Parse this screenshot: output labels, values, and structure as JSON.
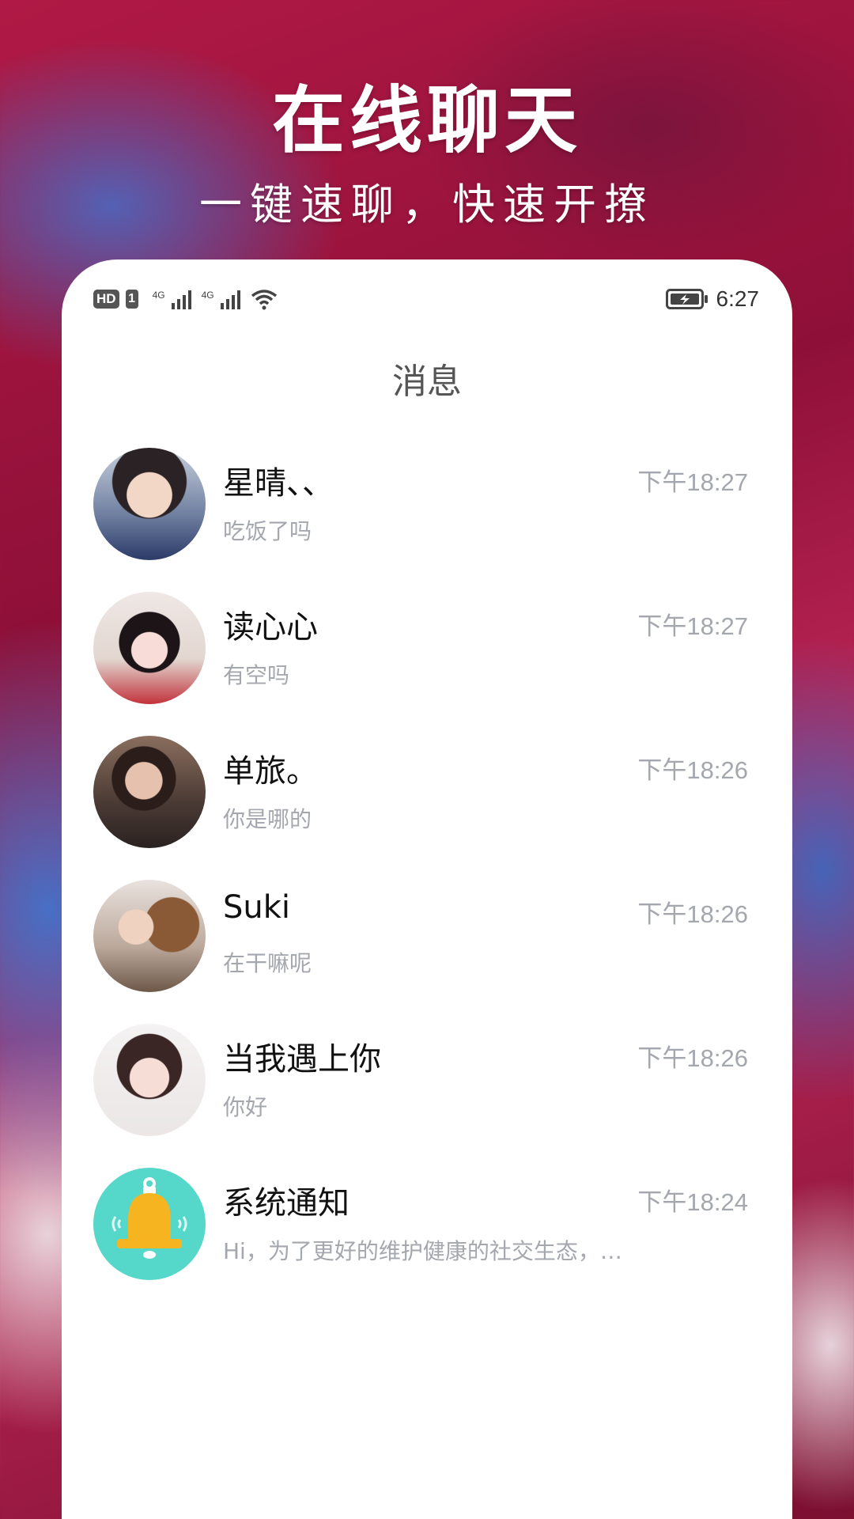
{
  "hero": {
    "title": "在线聊天",
    "subtitle": "一键速聊，快速开撩"
  },
  "status_bar": {
    "hd": "HD",
    "sim": "1",
    "net1": "4G",
    "net2": "4G",
    "time": "6:27",
    "icons": [
      "hd-icon",
      "sim-icon",
      "signal-icon",
      "signal-icon",
      "wifi-icon",
      "battery-charging-icon"
    ]
  },
  "page": {
    "title": "消息"
  },
  "conversations": [
    {
      "name": "星晴、、",
      "time": "下午18:27",
      "preview": "吃饭了吗",
      "avatar": "avatar-photo"
    },
    {
      "name": "读心心",
      "time": "下午18:27",
      "preview": "有空吗",
      "avatar": "avatar-photo"
    },
    {
      "name": "单旅。",
      "time": "下午18:26",
      "preview": "你是哪的",
      "avatar": "avatar-photo"
    },
    {
      "name": "Suki",
      "time": "下午18:26",
      "preview": "在干嘛呢",
      "avatar": "avatar-photo"
    },
    {
      "name": "当我遇上你",
      "time": "下午18:26",
      "preview": "你好",
      "avatar": "avatar-photo"
    },
    {
      "name": "系统通知",
      "time": "下午18:24",
      "preview": "Hi，为了更好的维护健康的社交生态，…",
      "avatar": "bell-icon"
    }
  ],
  "colors": {
    "card": "#ffffff",
    "name_text": "#111111",
    "meta_text": "#a4a7ae",
    "bell_bg": "#55d8c9",
    "bell_body": "#f6b420"
  }
}
